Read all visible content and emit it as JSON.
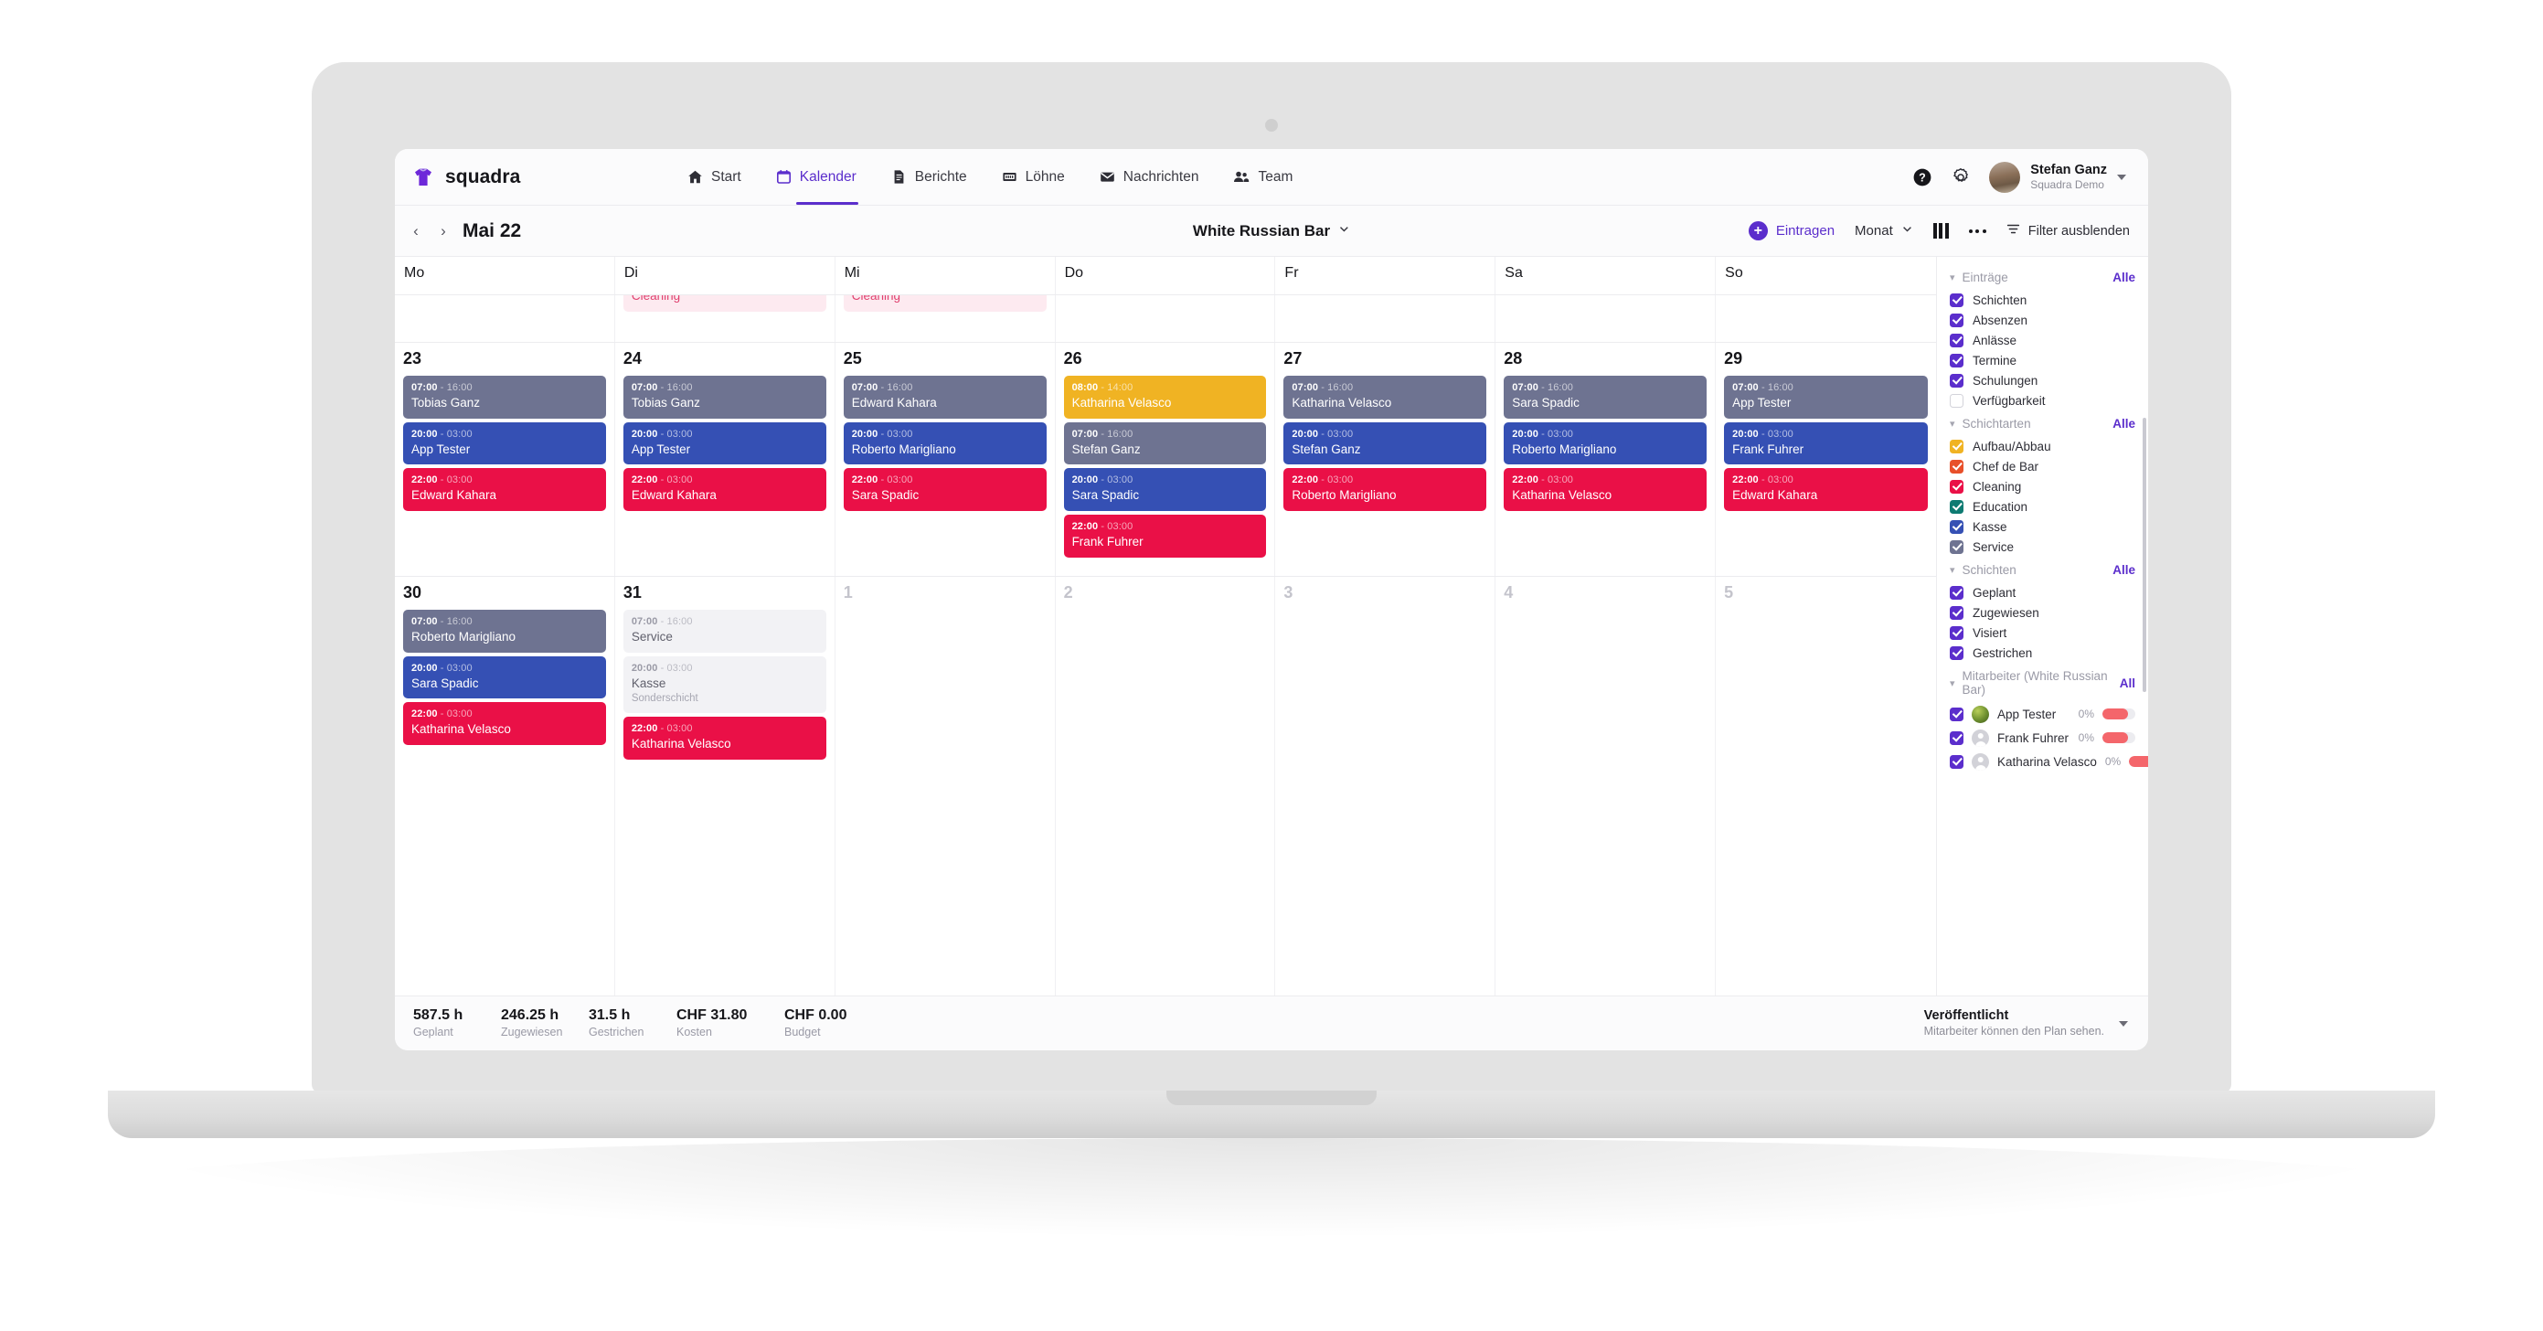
{
  "app": {
    "brand": "squadra",
    "logo_icon": "tshirt-icon"
  },
  "nav": {
    "items": [
      {
        "label": "Start",
        "icon": "home-icon",
        "active": false
      },
      {
        "label": "Kalender",
        "icon": "calendar-icon",
        "active": true
      },
      {
        "label": "Berichte",
        "icon": "document-icon",
        "active": false
      },
      {
        "label": "Löhne",
        "icon": "money-icon",
        "active": false
      },
      {
        "label": "Nachrichten",
        "icon": "envelope-icon",
        "active": false
      },
      {
        "label": "Team",
        "icon": "people-icon",
        "active": false
      }
    ],
    "help_icon": "help-circle-icon",
    "settings_icon": "gear-icon",
    "user": {
      "name": "Stefan Ganz",
      "org": "Squadra Demo",
      "avatar_icon": "user-avatar"
    }
  },
  "toolbar": {
    "prev_icon": "chevron-left-icon",
    "next_icon": "chevron-right-icon",
    "period": "Mai 22",
    "venue": "White Russian Bar",
    "venue_caret_icon": "chevron-down-icon",
    "add_label": "Eintragen",
    "add_icon": "plus-circle-icon",
    "view_label": "Monat",
    "view_caret_icon": "chevron-down-icon",
    "columns_icon": "columns-icon",
    "more_icon": "ellipsis-icon",
    "filter_icon": "filter-icon",
    "filter_label": "Filter ausblenden"
  },
  "calendar": {
    "weekdays": [
      "Mo",
      "Di",
      "Mi",
      "Do",
      "Fr",
      "Sa",
      "So"
    ],
    "clipped_row": [
      {
        "day": "",
        "cards": []
      },
      {
        "day": "",
        "cards": [
          {
            "name": "Cleaning",
            "style": "cleaning-light"
          }
        ]
      },
      {
        "day": "",
        "cards": [
          {
            "name": "Cleaning",
            "style": "cleaning-light"
          }
        ]
      },
      {
        "day": "",
        "cards": []
      },
      {
        "day": "",
        "cards": []
      },
      {
        "day": "",
        "cards": []
      },
      {
        "day": "",
        "cards": []
      }
    ],
    "week_23": [
      {
        "day": "23",
        "muted": false,
        "cards": [
          {
            "start": "07:00",
            "end": "16:00",
            "name": "Tobias Ganz",
            "style": "service"
          },
          {
            "start": "20:00",
            "end": "03:00",
            "name": "App Tester",
            "style": "kasse"
          },
          {
            "start": "22:00",
            "end": "03:00",
            "name": "Edward Kahara",
            "style": "cleaning"
          }
        ]
      },
      {
        "day": "24",
        "muted": false,
        "cards": [
          {
            "start": "07:00",
            "end": "16:00",
            "name": "Tobias Ganz",
            "style": "service"
          },
          {
            "start": "20:00",
            "end": "03:00",
            "name": "App Tester",
            "style": "kasse"
          },
          {
            "start": "22:00",
            "end": "03:00",
            "name": "Edward Kahara",
            "style": "cleaning"
          }
        ]
      },
      {
        "day": "25",
        "muted": false,
        "cards": [
          {
            "start": "07:00",
            "end": "16:00",
            "name": "Edward Kahara",
            "style": "service"
          },
          {
            "start": "20:00",
            "end": "03:00",
            "name": "Roberto Marigliano",
            "style": "kasse"
          },
          {
            "start": "22:00",
            "end": "03:00",
            "name": "Sara Spadic",
            "style": "cleaning"
          }
        ]
      },
      {
        "day": "26",
        "muted": false,
        "cards": [
          {
            "start": "08:00",
            "end": "14:00",
            "name": "Katharina Velasco",
            "style": "aufbau"
          },
          {
            "start": "07:00",
            "end": "16:00",
            "name": "Stefan Ganz",
            "style": "service"
          },
          {
            "start": "20:00",
            "end": "03:00",
            "name": "Sara Spadic",
            "style": "kasse"
          },
          {
            "start": "22:00",
            "end": "03:00",
            "name": "Frank Fuhrer",
            "style": "cleaning"
          }
        ]
      },
      {
        "day": "27",
        "muted": false,
        "cards": [
          {
            "start": "07:00",
            "end": "16:00",
            "name": "Katharina Velasco",
            "style": "service"
          },
          {
            "start": "20:00",
            "end": "03:00",
            "name": "Stefan Ganz",
            "style": "kasse"
          },
          {
            "start": "22:00",
            "end": "03:00",
            "name": "Roberto Marigliano",
            "style": "cleaning"
          }
        ]
      },
      {
        "day": "28",
        "muted": false,
        "cards": [
          {
            "start": "07:00",
            "end": "16:00",
            "name": "Sara Spadic",
            "style": "service"
          },
          {
            "start": "20:00",
            "end": "03:00",
            "name": "Roberto Marigliano",
            "style": "kasse"
          },
          {
            "start": "22:00",
            "end": "03:00",
            "name": "Katharina Velasco",
            "style": "cleaning"
          }
        ]
      },
      {
        "day": "29",
        "muted": false,
        "cards": [
          {
            "start": "07:00",
            "end": "16:00",
            "name": "App Tester",
            "style": "service"
          },
          {
            "start": "20:00",
            "end": "03:00",
            "name": "Frank Fuhrer",
            "style": "kasse"
          },
          {
            "start": "22:00",
            "end": "03:00",
            "name": "Edward Kahara",
            "style": "cleaning"
          }
        ]
      }
    ],
    "week_30": [
      {
        "day": "30",
        "muted": false,
        "cards": [
          {
            "start": "07:00",
            "end": "16:00",
            "name": "Roberto Marigliano",
            "style": "service"
          },
          {
            "start": "20:00",
            "end": "03:00",
            "name": "Sara Spadic",
            "style": "kasse"
          },
          {
            "start": "22:00",
            "end": "03:00",
            "name": "Katharina Velasco",
            "style": "cleaning"
          }
        ]
      },
      {
        "day": "31",
        "muted": false,
        "cards": [
          {
            "start": "07:00",
            "end": "16:00",
            "name": "Service",
            "style": "open"
          },
          {
            "start": "20:00",
            "end": "03:00",
            "name": "Kasse",
            "sub": "Sonderschicht",
            "style": "open"
          },
          {
            "start": "22:00",
            "end": "03:00",
            "name": "Katharina Velasco",
            "style": "cleaning"
          }
        ]
      },
      {
        "day": "1",
        "muted": true,
        "cards": []
      },
      {
        "day": "2",
        "muted": true,
        "cards": []
      },
      {
        "day": "3",
        "muted": true,
        "cards": []
      },
      {
        "day": "4",
        "muted": true,
        "cards": []
      },
      {
        "day": "5",
        "muted": true,
        "cards": []
      }
    ]
  },
  "filters": {
    "entries": {
      "title": "Einträge",
      "all_label": "Alle",
      "items": [
        {
          "label": "Schichten",
          "checked": true
        },
        {
          "label": "Absenzen",
          "checked": true
        },
        {
          "label": "Anlässe",
          "checked": true
        },
        {
          "label": "Termine",
          "checked": true
        },
        {
          "label": "Schulungen",
          "checked": true
        },
        {
          "label": "Verfügbarkeit",
          "checked": false
        }
      ]
    },
    "shift_types": {
      "title": "Schichtarten",
      "all_label": "Alle",
      "items": [
        {
          "label": "Aufbau/Abbau",
          "checked": true,
          "color": "#f0b323"
        },
        {
          "label": "Chef de Bar",
          "checked": true,
          "color": "#e8502a"
        },
        {
          "label": "Cleaning",
          "checked": true,
          "color": "#ea1047"
        },
        {
          "label": "Education",
          "checked": true,
          "color": "#0e7b72"
        },
        {
          "label": "Kasse",
          "checked": true,
          "color": "#3550b4"
        },
        {
          "label": "Service",
          "checked": true,
          "color": "#6e7391"
        }
      ]
    },
    "shifts": {
      "title": "Schichten",
      "all_label": "Alle",
      "items": [
        {
          "label": "Geplant",
          "checked": true
        },
        {
          "label": "Zugewiesen",
          "checked": true
        },
        {
          "label": "Visiert",
          "checked": true
        },
        {
          "label": "Gestrichen",
          "checked": true
        }
      ]
    },
    "employees": {
      "title": "Mitarbeiter (White Russian Bar)",
      "all_label": "All",
      "items": [
        {
          "name": "App Tester",
          "checked": true,
          "percent": "0%",
          "bar_fill": 78,
          "avatar": "photo"
        },
        {
          "name": "Frank Fuhrer",
          "checked": true,
          "percent": "0%",
          "bar_fill": 78,
          "avatar": "silhouette"
        },
        {
          "name": "Katharina Velasco",
          "checked": true,
          "percent": "0%",
          "bar_fill": 78,
          "avatar": "silhouette"
        }
      ]
    }
  },
  "footer": {
    "stats": [
      {
        "value": "587.5 h",
        "label": "Geplant"
      },
      {
        "value": "246.25 h",
        "label": "Zugewiesen"
      },
      {
        "value": "31.5 h",
        "label": "Gestrichen"
      },
      {
        "value": "CHF 31.80",
        "label": "Kosten"
      },
      {
        "value": "CHF 0.00",
        "label": "Budget"
      }
    ],
    "publish": {
      "status": "Veröffentlicht",
      "note": "Mitarbeiter können den Plan sehen.",
      "caret_icon": "caret-down-icon"
    }
  }
}
